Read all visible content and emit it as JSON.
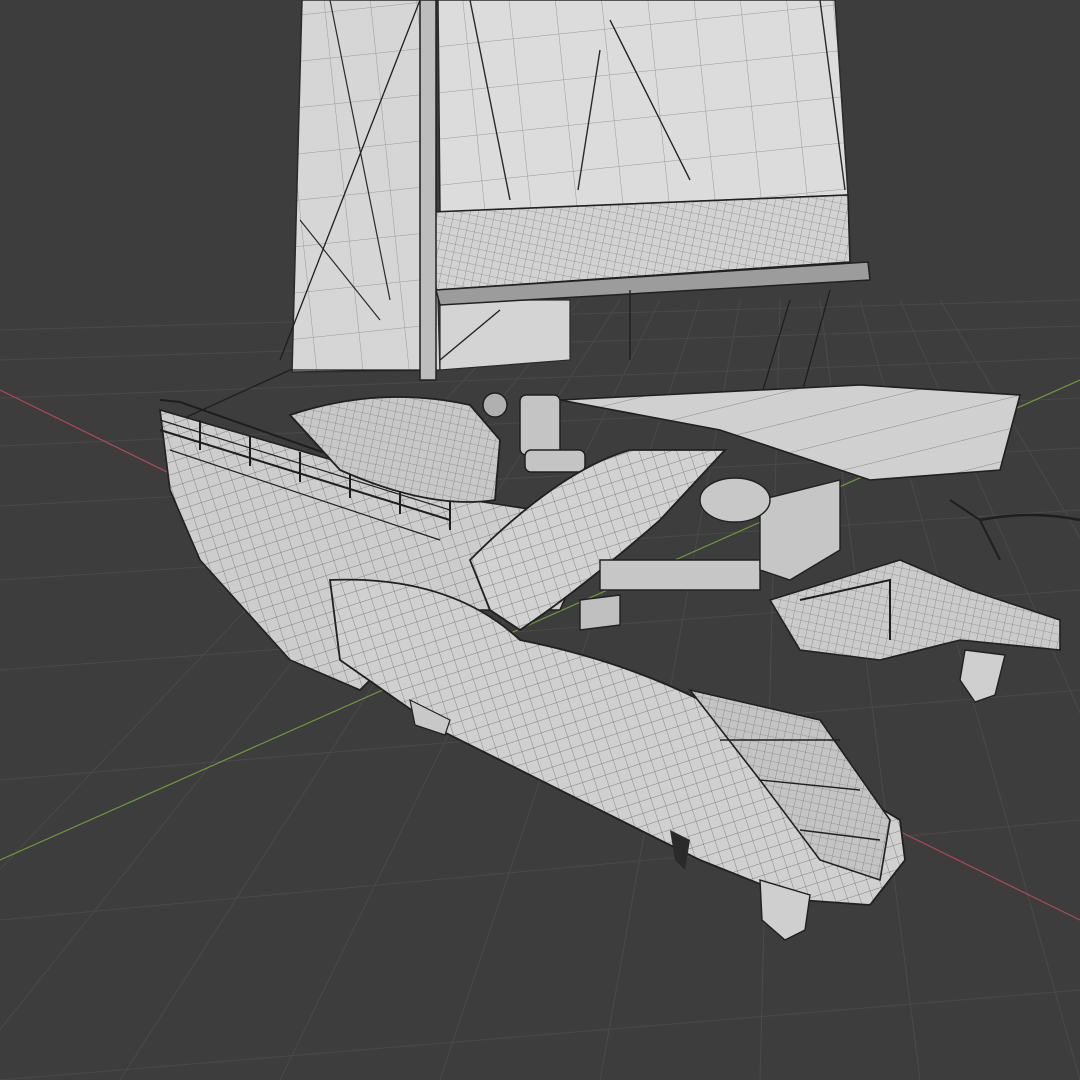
{
  "viewport": {
    "background": "#3d3d3d",
    "grid_color": "#4a4a4a",
    "x_axis_color": "#b04a56",
    "y_axis_color": "#6f9a3a"
  },
  "model": {
    "mesh_fill": "#cfcfcf",
    "mesh_shade": "#b9b9b9",
    "wire_color": "#5c5c5c",
    "edge_color": "#202020"
  }
}
